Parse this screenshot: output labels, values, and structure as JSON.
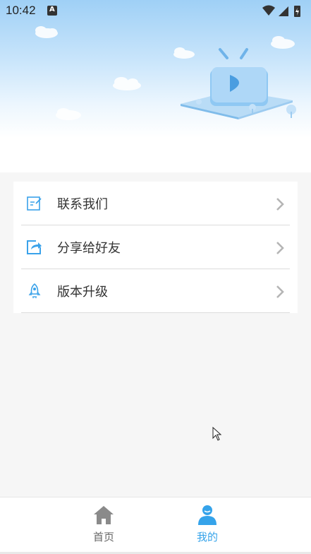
{
  "status_bar": {
    "time": "10:42",
    "notification_icon": "a-letter-icon",
    "icons": [
      "wifi-icon",
      "signal-icon",
      "battery-charging-icon"
    ]
  },
  "hero": {
    "illustration": "tv-play-illustration"
  },
  "menu": {
    "items": [
      {
        "label": "联系我们",
        "icon": "contact-edit-icon"
      },
      {
        "label": "分享给好友",
        "icon": "share-icon"
      },
      {
        "label": "版本升级",
        "icon": "rocket-icon"
      }
    ]
  },
  "bottom_nav": {
    "home_label": "首页",
    "mine_label": "我的",
    "active": "我的"
  },
  "colors": {
    "accent": "#35a3ea",
    "inactive": "#888888",
    "hero_top": "#9fd0f6"
  }
}
